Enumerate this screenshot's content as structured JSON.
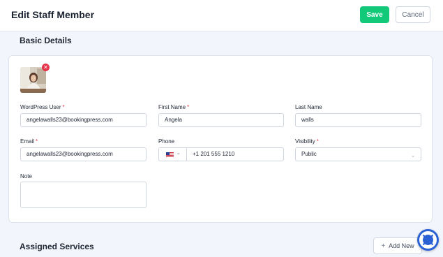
{
  "header": {
    "title": "Edit Staff Member",
    "save_label": "Save",
    "cancel_label": "Cancel"
  },
  "basic_details": {
    "title": "Basic Details",
    "fields": {
      "wp_user": {
        "label": "WordPress User",
        "required_mark": "*",
        "value": "angelawalls23@bookingpress.com"
      },
      "first_name": {
        "label": "First Name",
        "required_mark": "*",
        "value": "Angela"
      },
      "last_name": {
        "label": "Last Name",
        "value": "walls"
      },
      "email": {
        "label": "Email",
        "required_mark": "*",
        "value": "angelawalls23@bookingpress.com"
      },
      "phone": {
        "label": "Phone",
        "value": "+1 201 555 1210",
        "country_icon": "us-flag-icon"
      },
      "visibility": {
        "label": "Visibility",
        "required_mark": "*",
        "value": "Public"
      },
      "note": {
        "label": "Note",
        "value": ""
      }
    }
  },
  "assigned_services": {
    "title": "Assigned Services",
    "add_new_label": "Add New"
  },
  "colors": {
    "primary": "#12c97a",
    "required": "#e5344a",
    "fab": "#2a62d6"
  }
}
